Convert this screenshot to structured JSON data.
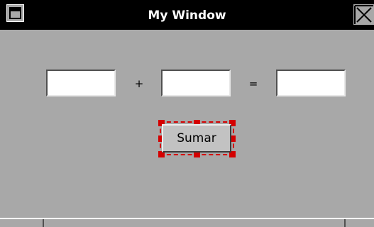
{
  "window": {
    "title": "My Window"
  },
  "form": {
    "operand1_value": "",
    "operator_plus": "+",
    "operand2_value": "",
    "operator_equals": "=",
    "result_value": ""
  },
  "buttons": {
    "sum_label": "Sumar"
  },
  "icons": {
    "window_menu": "window-menu-icon",
    "close": "close-icon"
  },
  "colors": {
    "window_background": "#a8a8a8",
    "titlebar": "#000000",
    "selection_handles": "#d40000"
  }
}
